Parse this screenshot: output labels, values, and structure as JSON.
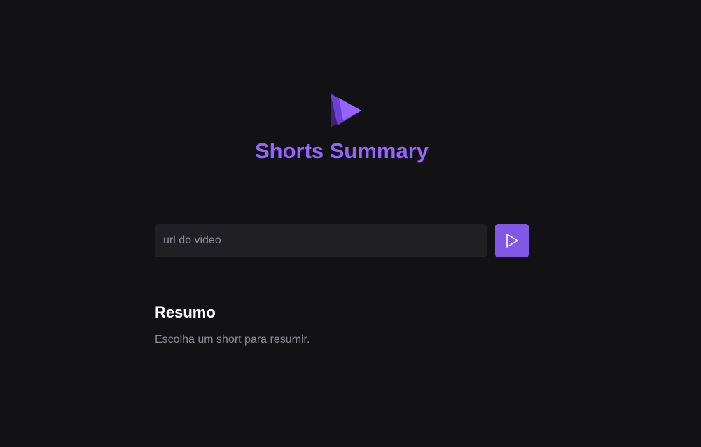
{
  "app": {
    "title": "Shorts Summary",
    "logo_icon": "play-triangle-logo-icon"
  },
  "form": {
    "url_placeholder": "url do video",
    "url_value": "",
    "submit_icon": "play-icon"
  },
  "summary": {
    "heading": "Resumo",
    "text": "Escolha um short para resumir."
  },
  "colors": {
    "background": "#121214",
    "accent": "#8257e5",
    "title": "#9466ff",
    "input_bg": "#202024",
    "muted_text": "#8d8d99"
  }
}
